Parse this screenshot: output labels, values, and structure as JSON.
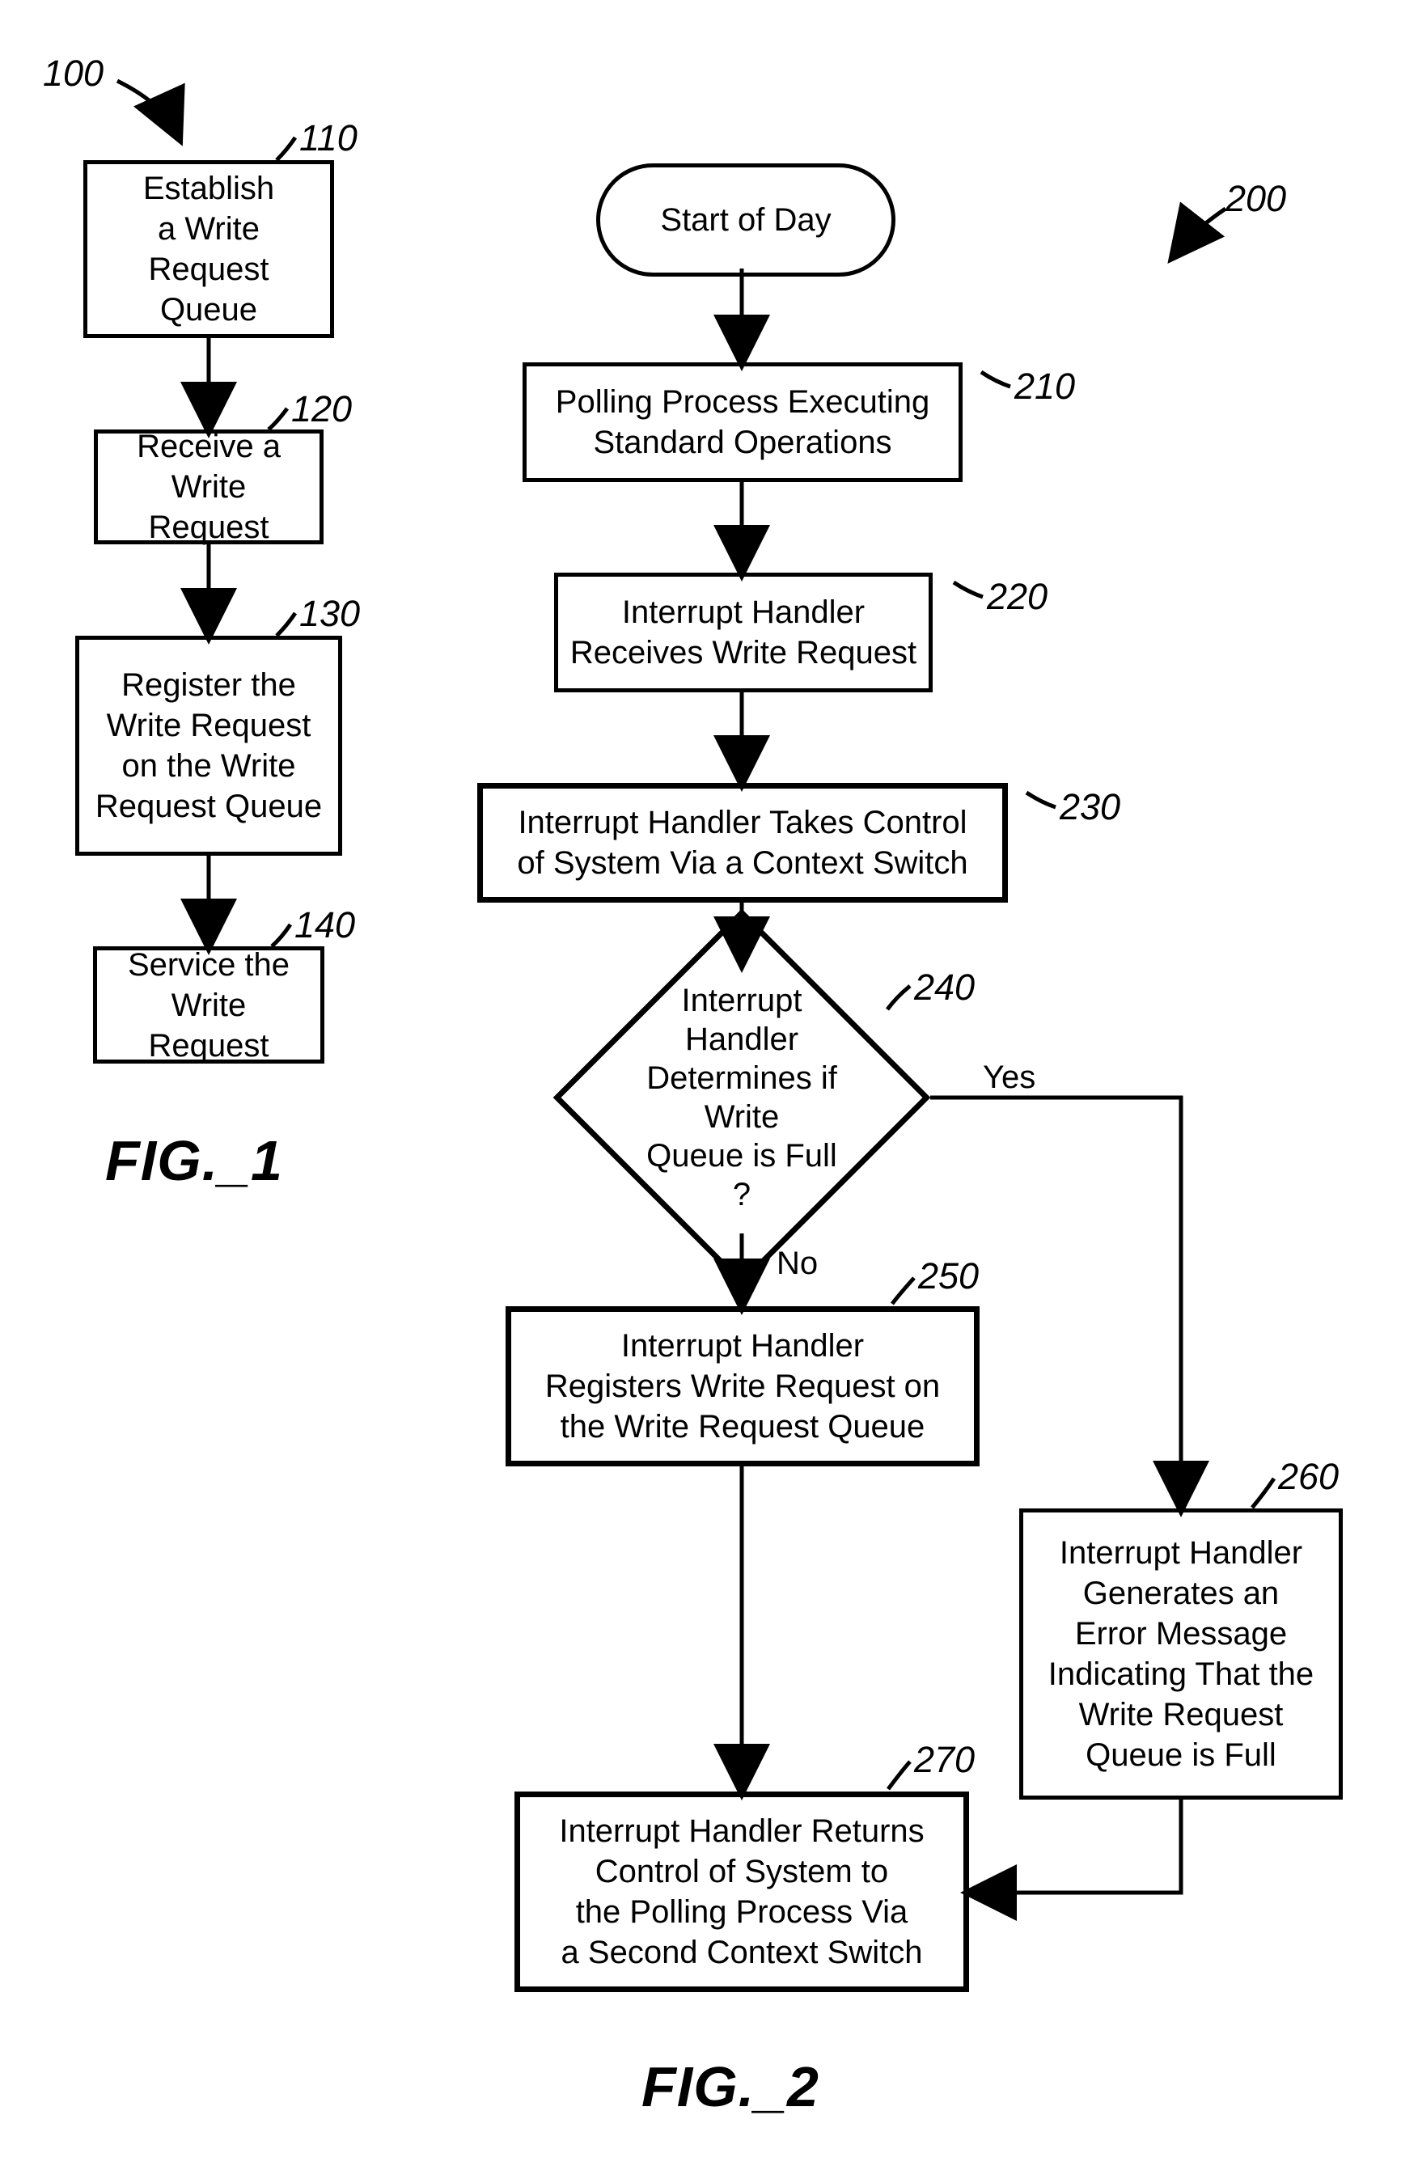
{
  "fig1": {
    "caption": "FIG._1",
    "ref_overall": "100",
    "steps": [
      {
        "ref": "110",
        "text": "Establish\na Write\nRequest Queue"
      },
      {
        "ref": "120",
        "text": "Receive a\nWrite Request"
      },
      {
        "ref": "130",
        "text": "Register the\nWrite Request\non the Write\nRequest Queue"
      },
      {
        "ref": "140",
        "text": "Service the\nWrite Request"
      }
    ]
  },
  "fig2": {
    "caption": "FIG._2",
    "ref_overall": "200",
    "start": "Start of Day",
    "steps": {
      "s210": {
        "ref": "210",
        "text": "Polling Process Executing\nStandard Operations"
      },
      "s220": {
        "ref": "220",
        "text": "Interrupt Handler\nReceives Write Request"
      },
      "s230": {
        "ref": "230",
        "text": "Interrupt Handler Takes Control\nof System Via a Context Switch"
      },
      "d240": {
        "ref": "240",
        "text": "Interrupt Handler\nDetermines if Write\nQueue is Full\n?",
        "yes": "Yes",
        "no": "No"
      },
      "s250": {
        "ref": "250",
        "text": "Interrupt Handler\nRegisters Write Request on\nthe Write Request Queue"
      },
      "s260": {
        "ref": "260",
        "text": "Interrupt Handler\nGenerates an\nError Message\nIndicating That the\nWrite Request\nQueue is Full"
      },
      "s270": {
        "ref": "270",
        "text": "Interrupt Handler Returns\nControl of System to\nthe Polling Process Via\na Second Context Switch"
      }
    }
  }
}
